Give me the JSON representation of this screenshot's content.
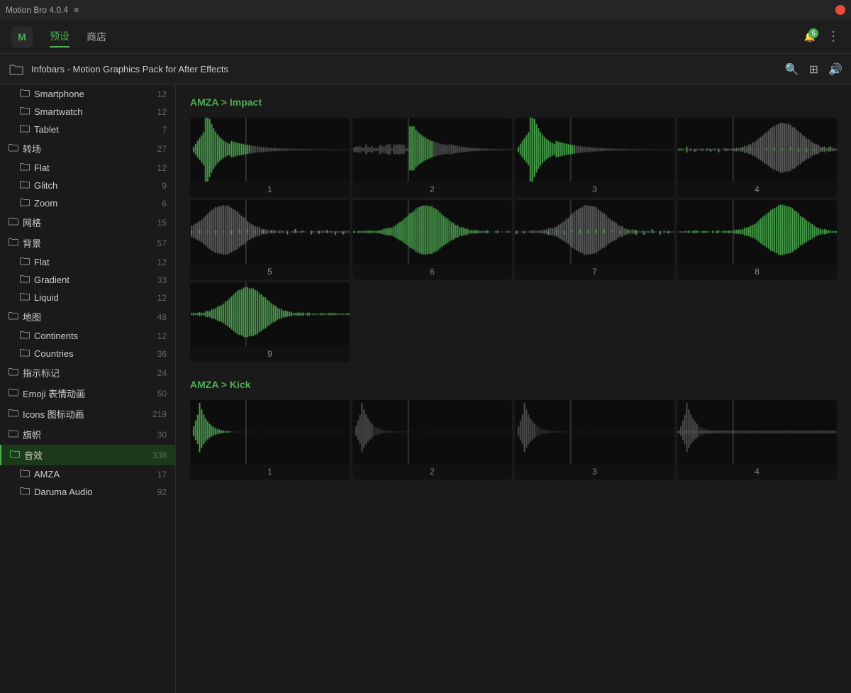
{
  "titlebar": {
    "app_name": "Motion Bro 4.0.4",
    "menu_icon": "≡"
  },
  "topnav": {
    "logo_text": "M",
    "nav_items": [
      {
        "label": "预设",
        "active": true
      },
      {
        "label": "商店",
        "active": false
      }
    ],
    "bell_count": "5",
    "more_icon": "⋮"
  },
  "content_toolbar": {
    "title": "Infobars - Motion Graphics Pack for After Effects",
    "search_icon": "🔍",
    "grid_icon": "⊞",
    "sound_icon": "🔊"
  },
  "sidebar": {
    "items": [
      {
        "label": "Smartphone",
        "count": "12",
        "indent": 1,
        "active": false
      },
      {
        "label": "Smartwatch",
        "count": "12",
        "indent": 1,
        "active": false
      },
      {
        "label": "Tablet",
        "count": "7",
        "indent": 1,
        "active": false
      },
      {
        "label": "转场",
        "count": "27",
        "indent": 0,
        "active": false
      },
      {
        "label": "Flat",
        "count": "12",
        "indent": 1,
        "active": false
      },
      {
        "label": "Glitch",
        "count": "9",
        "indent": 1,
        "active": false
      },
      {
        "label": "Zoom",
        "count": "6",
        "indent": 1,
        "active": false
      },
      {
        "label": "网格",
        "count": "15",
        "indent": 0,
        "active": false
      },
      {
        "label": "背景",
        "count": "57",
        "indent": 0,
        "active": false
      },
      {
        "label": "Flat",
        "count": "12",
        "indent": 1,
        "active": false
      },
      {
        "label": "Gradient",
        "count": "33",
        "indent": 1,
        "active": false
      },
      {
        "label": "Liquid",
        "count": "12",
        "indent": 1,
        "active": false
      },
      {
        "label": "地图",
        "count": "48",
        "indent": 0,
        "active": false
      },
      {
        "label": "Continents",
        "count": "12",
        "indent": 1,
        "active": false
      },
      {
        "label": "Countries",
        "count": "36",
        "indent": 1,
        "active": false
      },
      {
        "label": "指示标记",
        "count": "24",
        "indent": 0,
        "active": false
      },
      {
        "label": "Emoji 表情动画",
        "count": "50",
        "indent": 0,
        "active": false
      },
      {
        "label": "Icons 图标动画",
        "count": "219",
        "indent": 0,
        "active": false
      },
      {
        "label": "旗帜",
        "count": "30",
        "indent": 0,
        "active": false
      },
      {
        "label": "音效",
        "count": "338",
        "indent": 0,
        "active": true
      },
      {
        "label": "AMZA",
        "count": "17",
        "indent": 1,
        "active": false
      },
      {
        "label": "Daruma Audio",
        "count": "92",
        "indent": 1,
        "active": false
      }
    ]
  },
  "impact_section": {
    "breadcrumb_prefix": "AMZA > ",
    "title": "Impact",
    "items": [
      {
        "number": "1",
        "waveform_type": "impact_green"
      },
      {
        "number": "2",
        "waveform_type": "impact_gray"
      },
      {
        "number": "3",
        "waveform_type": "impact_green"
      },
      {
        "number": "4",
        "waveform_type": "impact_gray_right"
      },
      {
        "number": "5",
        "waveform_type": "impact_gray_left"
      },
      {
        "number": "6",
        "waveform_type": "impact_green_mid"
      },
      {
        "number": "7",
        "waveform_type": "impact_gray_mid"
      },
      {
        "number": "8",
        "waveform_type": "impact_green_right"
      },
      {
        "number": "9",
        "waveform_type": "impact_green_tall"
      }
    ]
  },
  "kick_section": {
    "breadcrumb_prefix": "AMZA > ",
    "title": "Kick",
    "items": [
      {
        "number": "1",
        "waveform_type": "kick_green"
      },
      {
        "number": "2",
        "waveform_type": "kick_gray"
      },
      {
        "number": "3",
        "waveform_type": "kick_gray2"
      },
      {
        "number": "4",
        "waveform_type": "kick_flat"
      }
    ]
  },
  "colors": {
    "accent": "#4CAF50",
    "background": "#1a1a1a",
    "card_bg": "#0d0d0d",
    "sidebar_active_bg": "#1a3a1a"
  }
}
